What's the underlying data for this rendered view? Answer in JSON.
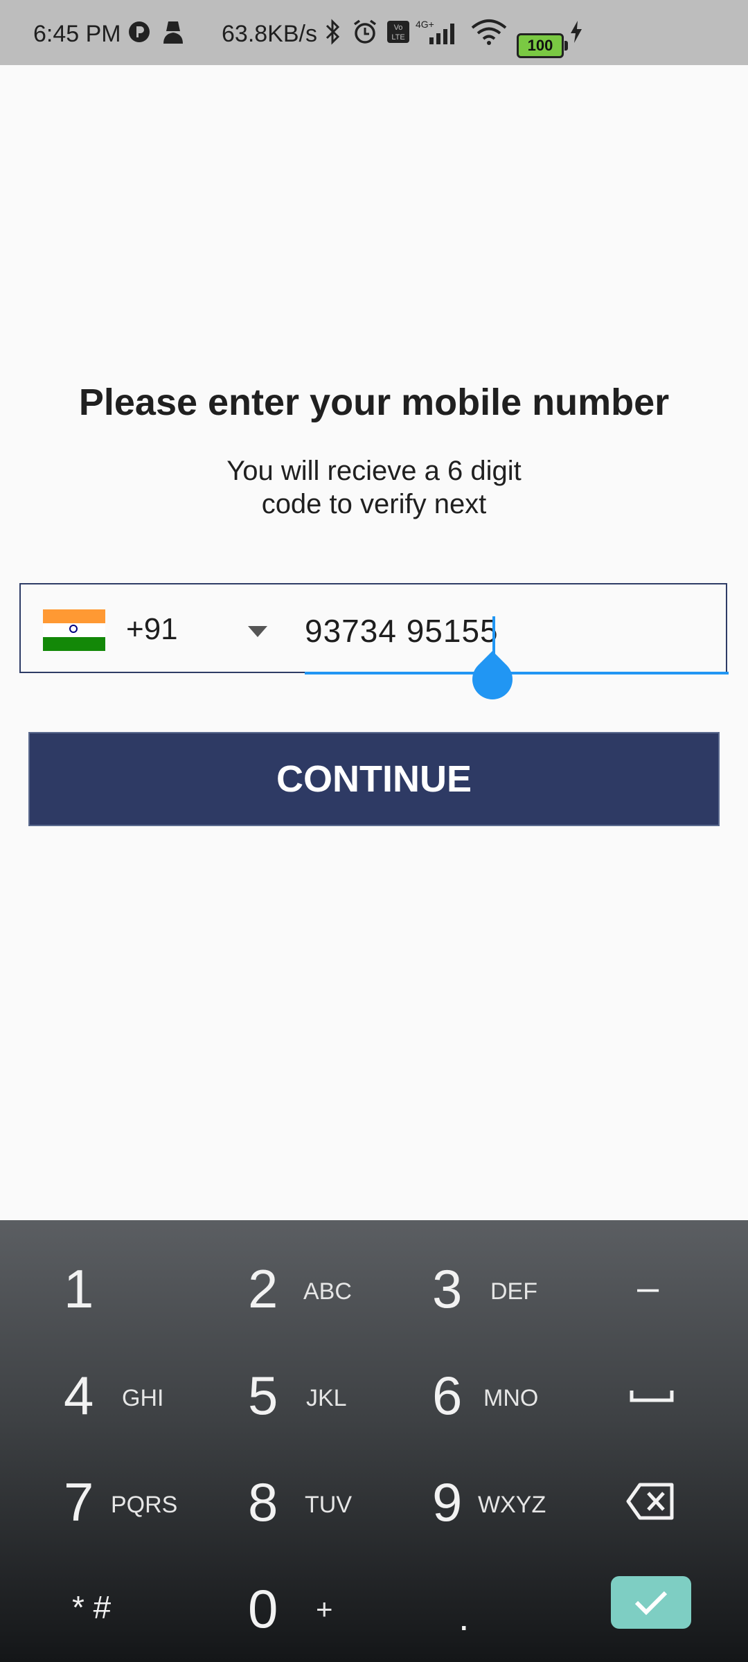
{
  "status_bar": {
    "time": "6:45 PM",
    "speed": "63.8KB/s",
    "network": "4G+",
    "volte": "Vo LTE",
    "battery": "100"
  },
  "heading": "Please enter your mobile number",
  "subtext_line1": "You will recieve a 6 digit",
  "subtext_line2": "code to verify next",
  "phone": {
    "country_code": "+91",
    "number": "93734 95155"
  },
  "continue_label": "CONTINUE",
  "keyboard": {
    "k1": {
      "digit": "1",
      "letters": ""
    },
    "k2": {
      "digit": "2",
      "letters": "ABC"
    },
    "k3": {
      "digit": "3",
      "letters": "DEF"
    },
    "k4": {
      "digit": "4",
      "letters": "GHI"
    },
    "k5": {
      "digit": "5",
      "letters": "JKL"
    },
    "k6": {
      "digit": "6",
      "letters": "MNO"
    },
    "k7": {
      "digit": "7",
      "letters": "PQRS"
    },
    "k8": {
      "digit": "8",
      "letters": "TUV"
    },
    "k9": {
      "digit": "9",
      "letters": "WXYZ"
    },
    "k0": {
      "digit": "0",
      "letters": "+"
    },
    "star_hash": "* #",
    "minus": "–",
    "dot": "."
  },
  "colors": {
    "accent": "#2196f3",
    "button_bg": "#2e3a64",
    "done_bg": "#7ecec3"
  }
}
